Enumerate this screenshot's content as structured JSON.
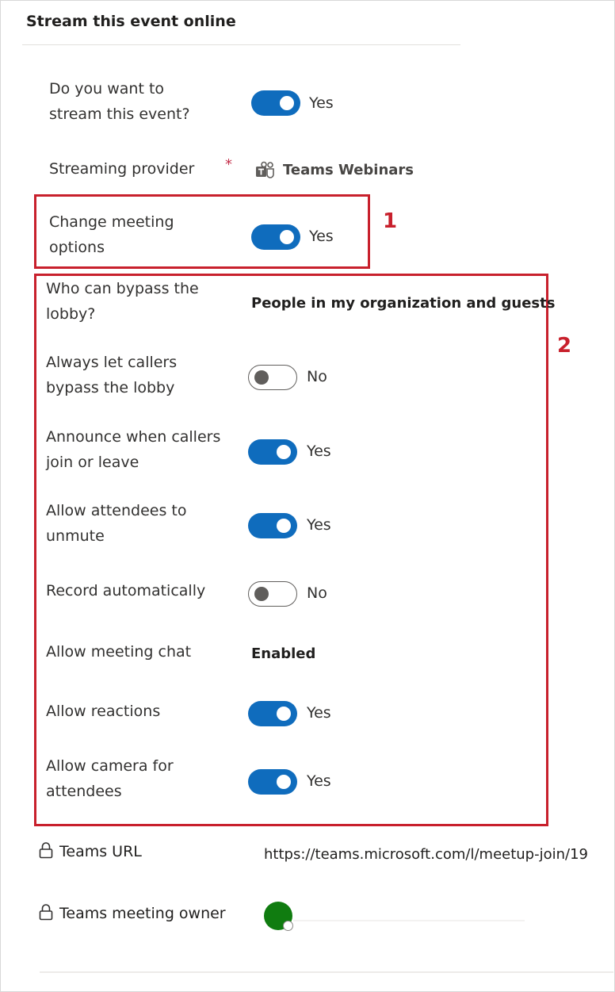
{
  "section": {
    "title": "Stream this event online"
  },
  "fields": {
    "stream_event": {
      "label": "Do you want to stream this event?",
      "value": "Yes",
      "on": true
    },
    "streaming_provider": {
      "label": "Streaming provider",
      "required_mark": "*",
      "value": "Teams Webinars",
      "icon": "teams-icon"
    },
    "change_meeting_options": {
      "label": "Change meeting options",
      "value": "Yes",
      "on": true
    },
    "bypass_lobby": {
      "label": "Who can bypass the lobby?",
      "value": "People in my organization and guests"
    },
    "callers_bypass": {
      "label": "Always let callers bypass the lobby",
      "value": "No",
      "on": false
    },
    "announce_callers": {
      "label": "Announce when callers join or leave",
      "value": "Yes",
      "on": true
    },
    "attendees_unmute": {
      "label": "Allow attendees to unmute",
      "value": "Yes",
      "on": true
    },
    "record_auto": {
      "label": "Record automatically",
      "value": "No",
      "on": false
    },
    "meeting_chat": {
      "label": "Allow meeting chat",
      "value": "Enabled"
    },
    "reactions": {
      "label": "Allow reactions",
      "value": "Yes",
      "on": true
    },
    "camera_attendees": {
      "label": "Allow camera for attendees",
      "value": "Yes",
      "on": true
    },
    "teams_url": {
      "label": "Teams URL",
      "value": "https://teams.microsoft.com/l/meetup-join/19",
      "icon": "lock-icon"
    },
    "meeting_owner": {
      "label": "Teams meeting owner",
      "icon": "lock-icon"
    }
  },
  "annotations": {
    "box1": "1",
    "box2": "2",
    "color": "#c8202c"
  },
  "colors": {
    "toggle_on": "#0f6cbd",
    "avatar": "#107c10"
  }
}
